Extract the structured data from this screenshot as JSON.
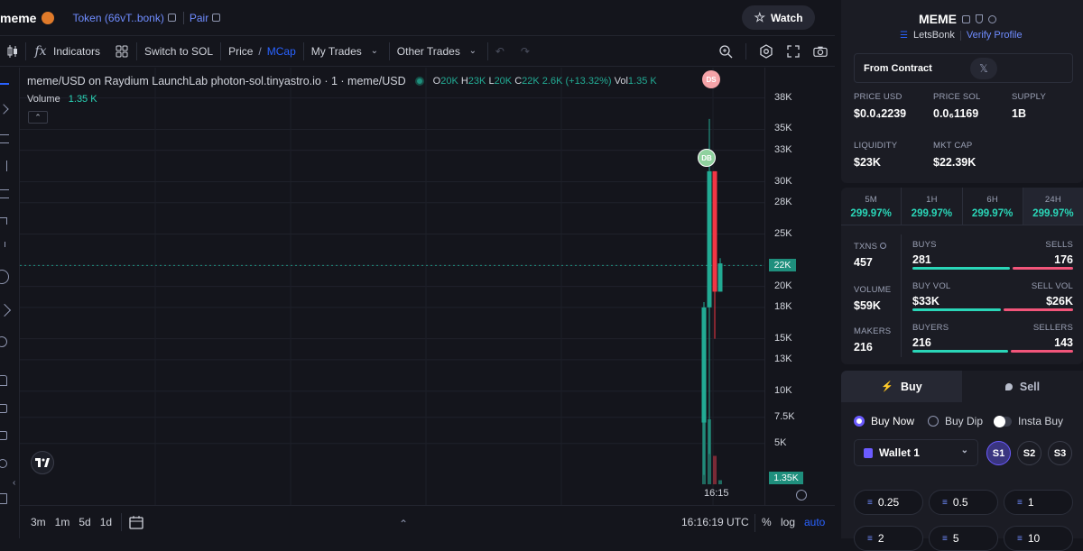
{
  "topbar": {
    "token_name": "meme",
    "token_addr": "Token (66vT..bonk)",
    "pair_label": "Pair",
    "watch_label": "Watch"
  },
  "toolbar": {
    "indicators": "Indicators",
    "switch_label": "Switch to SOL",
    "price_label": "Price",
    "mcap_label": "MCap",
    "my_trades": "My Trades",
    "other_trades": "Other Trades"
  },
  "chart": {
    "title": "meme/USD on Raydium LaunchLab photon-sol.tinyastro.io · 1 · meme/USD",
    "ohlc": {
      "o": "20K",
      "h": "23K",
      "l": "20K",
      "c": "22K",
      "change": "2.6K (+13.32%)",
      "vol": "1.35 K"
    },
    "volume_label": "Volume",
    "volume_value": "1.35 K",
    "price_ticks": [
      "38K",
      "35K",
      "33K",
      "30K",
      "28K",
      "25K",
      "22K",
      "20K",
      "18K",
      "15K",
      "13K",
      "10K",
      "7.5K",
      "5K"
    ],
    "current_price_tag": "22K",
    "volume_tag": "1.35K",
    "time_label": "16:15",
    "ds_label": "DS",
    "db_label": "DB"
  },
  "chart_data": {
    "type": "candlestick",
    "title": "meme/USD on Raydium LaunchLab photon-sol.tinyastro.io · 1 · meme/USD",
    "ylim": [
      3000,
      39000
    ],
    "y_ticks": [
      5000,
      7500,
      10000,
      13000,
      15000,
      18000,
      20000,
      22000,
      25000,
      28000,
      30000,
      33000,
      35000,
      38000
    ],
    "candles": [
      {
        "o": 7000,
        "h": 18500,
        "l": 2000,
        "c": 18000,
        "dir": "up"
      },
      {
        "o": 18000,
        "h": 36000,
        "l": 4000,
        "c": 31000,
        "dir": "up"
      },
      {
        "o": 31000,
        "h": 31000,
        "l": 15000,
        "c": 19500,
        "dir": "down"
      },
      {
        "o": 19500,
        "h": 22700,
        "l": 19500,
        "c": 22200,
        "dir": "up"
      }
    ],
    "volumes": [
      1.0,
      0.8,
      0.35,
      0.05
    ],
    "current_price": 22000
  },
  "bottombar": {
    "intervals": [
      "3m",
      "1m",
      "5d",
      "1d"
    ],
    "clock": "16:16:19 UTC",
    "pct": "%",
    "log": "log",
    "auto": "auto"
  },
  "panel": {
    "symbol": "MEME",
    "platform": "LetsBonk",
    "verify": "Verify Profile",
    "from_contract": "From Contract",
    "price_usd_label": "PRICE USD",
    "price_usd": "$0.0₄2239",
    "price_sol_label": "PRICE SOL",
    "price_sol": "0.0₆1169",
    "supply_label": "SUPPLY",
    "supply": "1B",
    "liquidity_label": "LIQUIDITY",
    "liquidity": "$23K",
    "mcap_label": "MKT CAP",
    "mcap": "$22.39K",
    "periods": [
      {
        "label": "5M",
        "value": "299.97%"
      },
      {
        "label": "1H",
        "value": "299.97%"
      },
      {
        "label": "6H",
        "value": "299.97%"
      },
      {
        "label": "24H",
        "value": "299.97%"
      }
    ],
    "txns_label": "TXNS",
    "txns": "457",
    "buys_label": "BUYS",
    "buys": "281",
    "sells_label": "SELLS",
    "sells": "176",
    "volume_label": "VOLUME",
    "volume": "$59K",
    "buy_vol_label": "BUY VOL",
    "buy_vol": "$33K",
    "sell_vol_label": "SELL VOL",
    "sell_vol": "$26K",
    "makers_label": "MAKERS",
    "makers": "216",
    "buyers_label": "BUYERS",
    "buyers": "216",
    "sellers_label": "SELLERS",
    "sellers": "143",
    "buy_tab": "Buy",
    "sell_tab": "Sell",
    "buy_now": "Buy Now",
    "buy_dip": "Buy Dip",
    "insta_buy": "Insta Buy",
    "wallet": "Wallet 1",
    "slots": [
      "S1",
      "S2",
      "S3"
    ],
    "amounts": [
      "0.25",
      "0.5",
      "1",
      "2",
      "5",
      "10"
    ]
  }
}
